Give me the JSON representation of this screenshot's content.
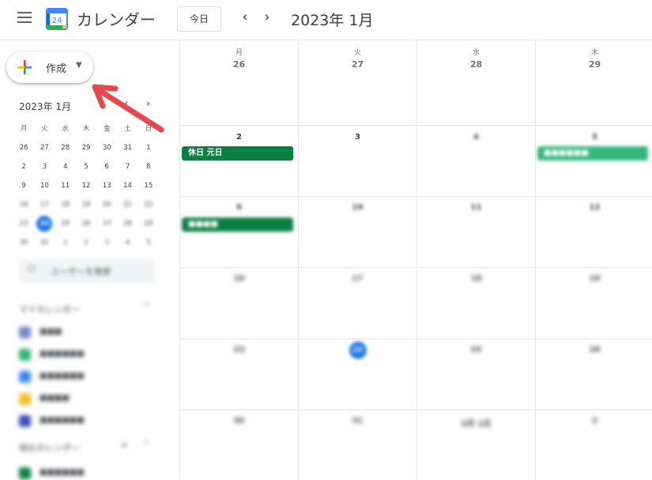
{
  "header": {
    "app_title": "カレンダー",
    "logo_day": "24",
    "today_label": "今日",
    "prev_glyph": "‹",
    "next_glyph": "›",
    "month_label": "2023年 1月"
  },
  "sidebar": {
    "create_label": "作成",
    "mini_calendar": {
      "title": "2023年 1月",
      "weekdays": [
        "月",
        "火",
        "水",
        "木",
        "金",
        "土",
        "日"
      ],
      "weeks": [
        [
          "26",
          "27",
          "28",
          "29",
          "30",
          "31",
          "1"
        ],
        [
          "2",
          "3",
          "4",
          "5",
          "6",
          "7",
          "8"
        ],
        [
          "9",
          "10",
          "11",
          "12",
          "13",
          "14",
          "15"
        ],
        [
          "16",
          "17",
          "18",
          "19",
          "20",
          "21",
          "22"
        ],
        [
          "23",
          "24",
          "25",
          "26",
          "27",
          "28",
          "29"
        ],
        [
          "30",
          "31",
          "1",
          "2",
          "3",
          "4",
          "5"
        ]
      ],
      "today": "24"
    },
    "user_search_placeholder": "ユーザーを検索",
    "my_calendars_title": "マイカレンダー",
    "other_calendars_title": "他のカレンダー",
    "my_calendars": [
      {
        "label": "■■■",
        "color": "#7986cb"
      },
      {
        "label": "■■■■■■",
        "color": "#33b679"
      },
      {
        "label": "■■■■■■",
        "color": "#4285f4"
      },
      {
        "label": "■■■■",
        "color": "#f6bf26"
      },
      {
        "label": "■■■■■■",
        "color": "#3f51b5"
      }
    ],
    "other_calendars": [
      {
        "label": "■■■■■■",
        "color": "#0b8043"
      }
    ]
  },
  "main": {
    "days": [
      {
        "dow": "月",
        "num": "26"
      },
      {
        "dow": "火",
        "num": "27"
      },
      {
        "dow": "水",
        "num": "28"
      },
      {
        "dow": "木",
        "num": "29"
      }
    ],
    "rows": [
      [
        "2",
        "3",
        "4",
        "5"
      ],
      [
        "9",
        "10",
        "11",
        "12"
      ],
      [
        "16",
        "17",
        "18",
        "19"
      ],
      [
        "23",
        "24",
        "25",
        "26"
      ],
      [
        "30",
        "31",
        "2月 1日",
        "2"
      ]
    ],
    "events": {
      "holiday": "休日 元日",
      "thu_event": "■■■■■■",
      "second_week": "■■■■"
    },
    "colors": {
      "event_green": "#0b8043",
      "event_light_green": "#33b679",
      "today_blue": "#1a73e8"
    }
  }
}
